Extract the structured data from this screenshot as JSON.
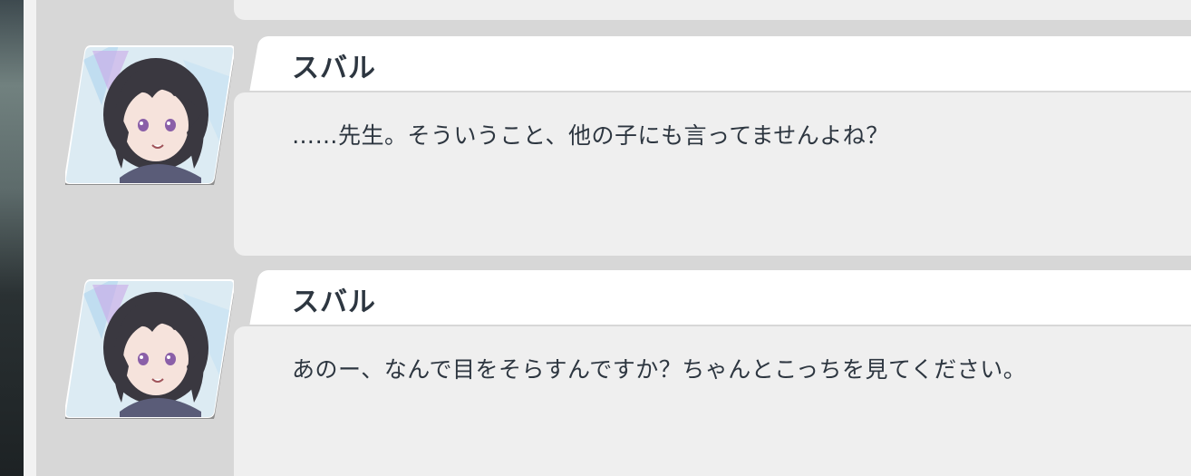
{
  "log": {
    "entries": [
      {
        "speaker": "スバル",
        "text": "……先生。そういうこと、他の子にも言ってませんよね？",
        "avatar_icon": "character-portrait-icon"
      },
      {
        "speaker": "スバル",
        "text": "あのー、なんで目をそらすんですか？ちゃんとこっちを見てください。",
        "avatar_icon": "character-portrait-icon"
      }
    ]
  },
  "colors": {
    "panel_bg": "#d7d7d7",
    "bubble_bg": "#efefef",
    "name_tab_bg": "#ffffff",
    "text": "#2d3640",
    "hair": "#3a3840",
    "eyes": "#8a5fa8"
  }
}
